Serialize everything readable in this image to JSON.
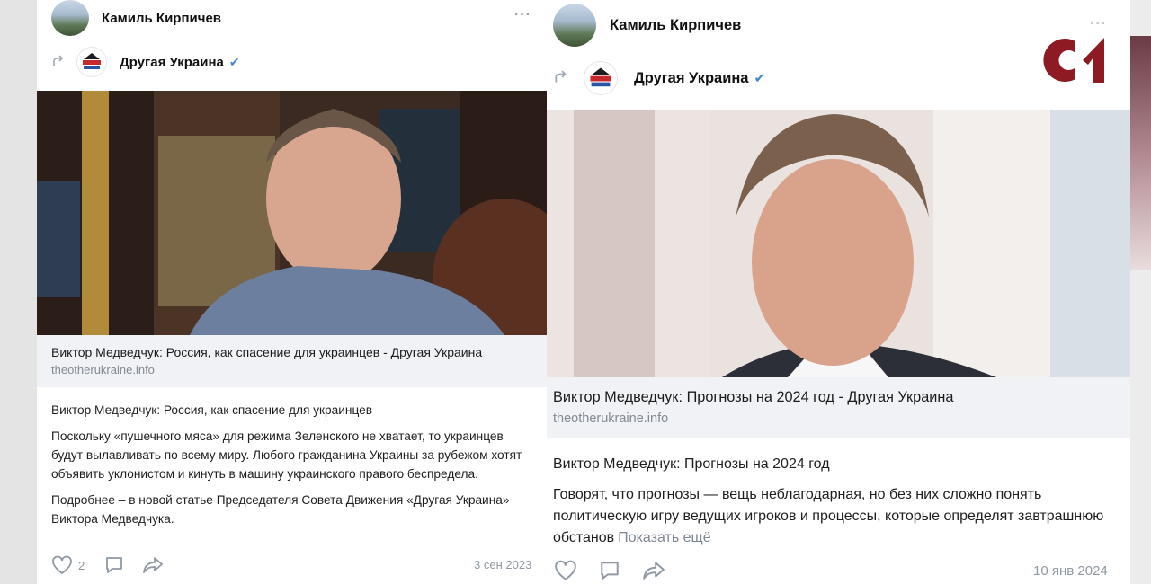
{
  "colors": {
    "accent_logo": "#8e1b24",
    "verified": "#4a86c5"
  },
  "left_post": {
    "author": "Камиль Кирпичев",
    "more_icon": "···",
    "repost_group": "Другая Украина",
    "link_title": "Виктор Медведчук: Россия, как спасение для украинцев - Другая Украина",
    "link_domain": "theotherukraine.info",
    "p1": "Виктор Медведчук: Россия, как спасение для украинцев",
    "p2": "Поскольку «пушечного мяса» для режима Зеленского не хватает, то украинцев будут вылавливать по всему миру. Любого гражданина Украины за рубежом хотят объявить уклонистом и кинуть в машину украинского правого беспредела.",
    "p3": "Подробнее – в новой статье Председателя Совета Движения «Другая Украина» Виктора Медведчука.",
    "likes": "2",
    "date": "3 сен 2023"
  },
  "right_post": {
    "author": "Камиль Кирпичев",
    "more_icon": "···",
    "repost_group": "Другая Украина",
    "link_title": "Виктор Медведчук: Прогнозы на 2024 год - Другая Украина",
    "link_domain": "theotherukraine.info",
    "p1": "Виктор Медведчук: Прогнозы на 2024 год",
    "p2": "Говорят, что прогнозы — вещь неблагодарная, но без них сложно понять политическую игру ведущих игроков и процессы, которые определят завтрашнюю обстанов",
    "show_more": "Показать ещё",
    "date": "10 янв 2024"
  },
  "icons": {
    "like": "heart-icon",
    "comment": "comment-icon",
    "share": "share-icon",
    "repost": "repost-arrow-icon",
    "verified": "verified-check-icon"
  }
}
